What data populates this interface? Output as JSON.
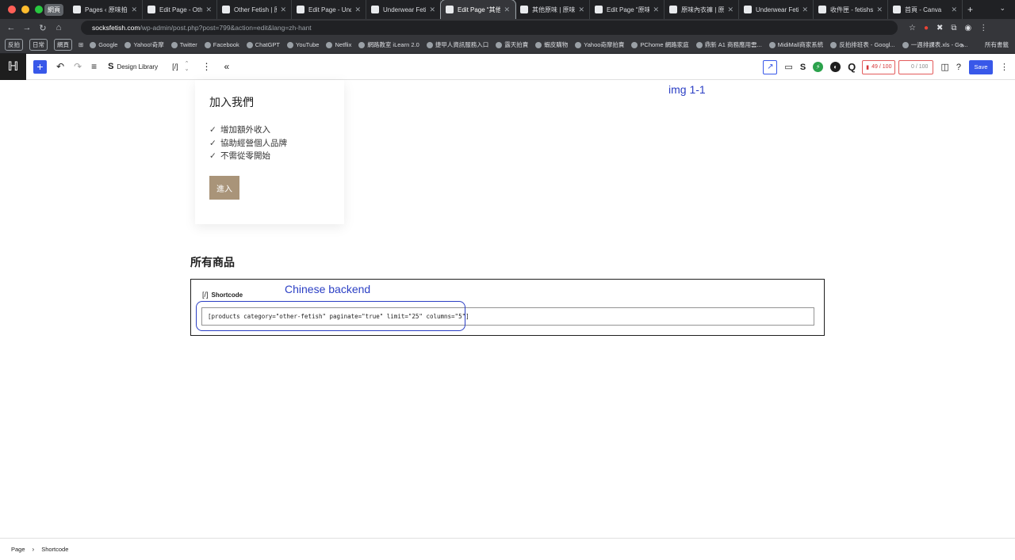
{
  "browser": {
    "tab_group_label": "網頁",
    "tabs": [
      {
        "label": "Pages ‹ 原味拍賣",
        "active": false
      },
      {
        "label": "Edit Page - Other",
        "active": false
      },
      {
        "label": "Other Fetish | 原味",
        "active": false
      },
      {
        "label": "Edit Page - Under",
        "active": false
      },
      {
        "label": "Underwear Fetish",
        "active": false
      },
      {
        "label": "Edit Page “其他原",
        "active": true
      },
      {
        "label": "其他原味 | 原味拍賣",
        "active": false
      },
      {
        "label": "Edit Page “原味內",
        "active": false
      },
      {
        "label": "原味內衣褲 | 原味拍",
        "active": false
      },
      {
        "label": "Underwear Fetish",
        "active": false
      },
      {
        "label": "收件匣 - fetishsh",
        "active": false
      },
      {
        "label": "首頁 - Canva",
        "active": false
      }
    ],
    "new_tab": "+",
    "url_host": "socksfetish.com",
    "url_path": "/wp-admin/post.php?post=799&action=edit&lang=zh-hant",
    "bookmark_chips": [
      "反拍",
      "日常",
      "網頁"
    ],
    "bookmarks": [
      "Google",
      "Yahoo!奇摩",
      "Twitter",
      "Facebook",
      "ChatGPT",
      "YouTube",
      "Netflix",
      "網路教室 iLearn 2.0",
      "捷甲人資訊服務入口",
      "露天拍賣",
      "蝦皮購物",
      "Yahoo奇摩拍賣",
      "PChome 網路家庭",
      "鼎新 A1 商務應用雲...",
      "MidiMall商家系統",
      "反拍排班表 - Googl...",
      "一週排課表.xls - Go..."
    ],
    "bookmarks_more": "»",
    "all_bookmarks": "所有書籤"
  },
  "toolbar": {
    "add_label": "+",
    "design_library": "Design Library",
    "shortcode_icon": "[/]",
    "score_left": "49 / 100",
    "score_right": "0 / 100",
    "save_label": "Save"
  },
  "content": {
    "join_title": "加入我們",
    "join_items": [
      "增加額外收入",
      "協助經營個人品牌",
      "不需從零開始"
    ],
    "join_button": "進入",
    "annotation_img": "img 1-1",
    "section_title": "所有商品",
    "shortcode_block_label": "Shortcode",
    "shortcode_block_icon": "[/]",
    "shortcode_value": "[products category=\"other-fetish\" paginate=\"true\" limit=\"25\" columns=\"5\"]",
    "annotation_backend": "Chinese backend"
  },
  "footer": {
    "breadcrumb": [
      "Page",
      "Shortcode"
    ]
  },
  "colors": {
    "wp_accent": "#3858e9",
    "annotation_blue": "#2b3fc4",
    "join_button_bg": "#a99479"
  }
}
